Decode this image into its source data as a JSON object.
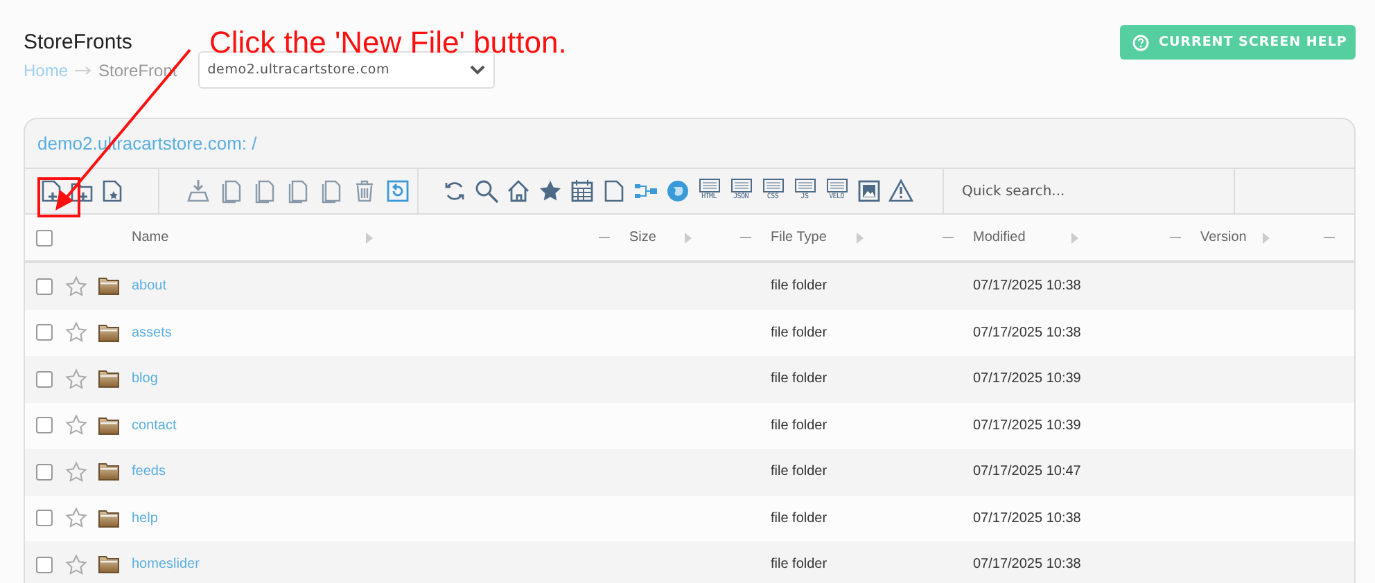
{
  "page": {
    "title": "StoreFronts",
    "help_button": "CURRENT SCREEN HELP",
    "breadcrumb": [
      "Home",
      "StoreFront"
    ],
    "store_select": {
      "value": "demo2.ultracartstore.com"
    }
  },
  "annotation": {
    "text": "Click the 'New File' button."
  },
  "panel": {
    "path": "demo2.ultracartstore.com: /",
    "toolbar": {
      "file_type_labels": [
        "HTML",
        "JSON",
        "CSS",
        "JS",
        "VELO"
      ],
      "search": {
        "placeholder": "Quick search..."
      }
    },
    "table": {
      "columns": [
        "Name",
        "Size",
        "File Type",
        "Modified",
        "Version"
      ],
      "select_all": {
        "checked": false
      },
      "rows": [
        {
          "name": "about",
          "type": "file folder",
          "modified": "07/17/2025 10:38",
          "checked": false,
          "starred": false
        },
        {
          "name": "assets",
          "type": "file folder",
          "modified": "07/17/2025 10:38",
          "checked": false,
          "starred": false
        },
        {
          "name": "blog",
          "type": "file folder",
          "modified": "07/17/2025 10:39",
          "checked": false,
          "starred": false
        },
        {
          "name": "contact",
          "type": "file folder",
          "modified": "07/17/2025 10:39",
          "checked": false,
          "starred": false
        },
        {
          "name": "feeds",
          "type": "file folder",
          "modified": "07/17/2025 10:47",
          "checked": false,
          "starred": false
        },
        {
          "name": "help",
          "type": "file folder",
          "modified": "07/17/2025 10:38",
          "checked": false,
          "starred": false
        },
        {
          "name": "homeslider",
          "type": "file folder",
          "modified": "07/17/2025 10:38",
          "checked": false,
          "starred": false
        }
      ]
    }
  }
}
